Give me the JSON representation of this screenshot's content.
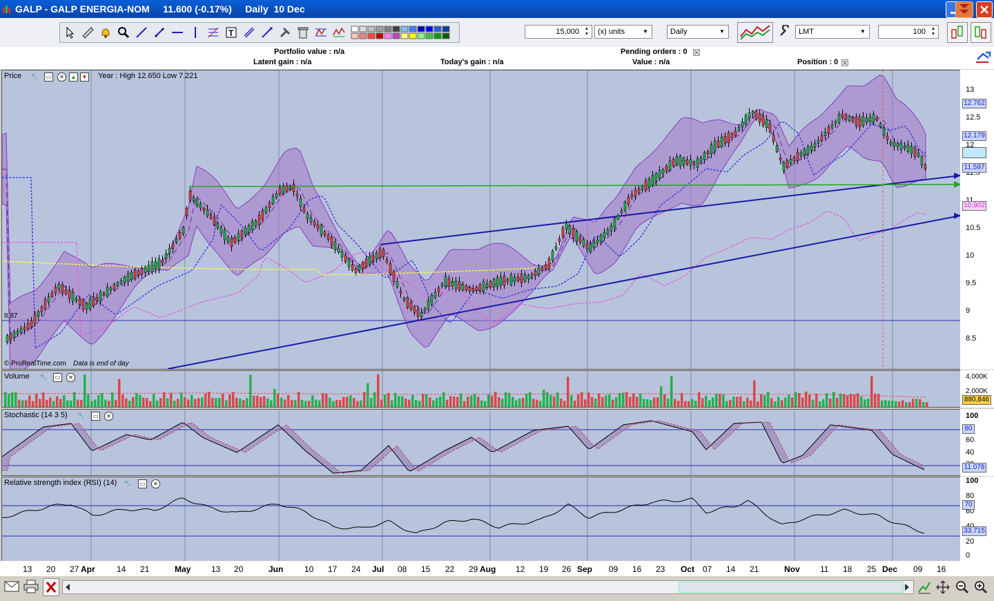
{
  "window": {
    "title": "GALP - GALP ENERGIA-NOM     11.600 (-0.17%)     Daily  10 Dec"
  },
  "toolbar": {
    "quantity": "15,000",
    "units": "(x) units",
    "timeframe": "Daily",
    "order_type": "LMT",
    "amount": "100"
  },
  "info": {
    "portfolio_value": "Portfolio value : n/a",
    "latent_gain": "Latent gain : n/a",
    "todays_gain": "Today's gain : n/a",
    "pending_orders": "Pending orders : 0",
    "value": "Value : n/a",
    "position": "Position : 0"
  },
  "price_panel": {
    "title": "Price",
    "year_range": "Year : High 12.650 Low 7.221",
    "footer_brand": "© ProRealTime.com",
    "footer_note": "Data is end of day",
    "low_marker": "8.87",
    "axis_ticks": [
      "13",
      "12.5",
      "12",
      "11.5",
      "11",
      "10.5",
      "10",
      "9.5",
      "9",
      "8.5"
    ],
    "badges": {
      "upper_band": "12.762",
      "mid_band": "12.179",
      "last_price": "11.597",
      "ma": "10.902"
    },
    "colors": {
      "band_fill": "#a478c8",
      "up_candle": "#22b14c",
      "down_candle": "#d84848",
      "trendline": "#1a1aa8",
      "support": "#1ea81e",
      "ma_fast": "#4040e0",
      "ma_slow": "#e060e0",
      "ma_long": "#ffff40"
    }
  },
  "volume_panel": {
    "title": "Volume",
    "axis_ticks": [
      "4,000K",
      "2,000K"
    ],
    "badge": "880,846"
  },
  "stochastic_panel": {
    "title": "Stochastic (14 3 5)",
    "axis_ticks": [
      "100",
      "80",
      "60",
      "40",
      "20"
    ],
    "badges": {
      "level": "80",
      "value": "11.078"
    }
  },
  "rsi_panel": {
    "title": "Relative strength index (RSI) (14)",
    "axis_ticks": [
      "100",
      "80",
      "60",
      "40",
      "20",
      "0"
    ],
    "badges": {
      "level": "70",
      "value": "33.715"
    }
  },
  "x_axis": {
    "labels": [
      {
        "text": "13",
        "bold": false
      },
      {
        "text": "20",
        "bold": false
      },
      {
        "text": "27",
        "bold": false
      },
      {
        "text": "Apr",
        "bold": true
      },
      {
        "text": "14",
        "bold": false
      },
      {
        "text": "21",
        "bold": false
      },
      {
        "text": "May",
        "bold": true
      },
      {
        "text": "13",
        "bold": false
      },
      {
        "text": "20",
        "bold": false
      },
      {
        "text": "Jun",
        "bold": true
      },
      {
        "text": "10",
        "bold": false
      },
      {
        "text": "17",
        "bold": false
      },
      {
        "text": "24",
        "bold": false
      },
      {
        "text": "Jul",
        "bold": true
      },
      {
        "text": "08",
        "bold": false
      },
      {
        "text": "15",
        "bold": false
      },
      {
        "text": "22",
        "bold": false
      },
      {
        "text": "29",
        "bold": false
      },
      {
        "text": "Aug",
        "bold": true
      },
      {
        "text": "12",
        "bold": false
      },
      {
        "text": "19",
        "bold": false
      },
      {
        "text": "26",
        "bold": false
      },
      {
        "text": "Sep",
        "bold": true
      },
      {
        "text": "09",
        "bold": false
      },
      {
        "text": "16",
        "bold": false
      },
      {
        "text": "23",
        "bold": false
      },
      {
        "text": "Oct",
        "bold": true
      },
      {
        "text": "07",
        "bold": false
      },
      {
        "text": "14",
        "bold": false
      },
      {
        "text": "21",
        "bold": false
      },
      {
        "text": "Nov",
        "bold": true
      },
      {
        "text": "11",
        "bold": false
      },
      {
        "text": "18",
        "bold": false
      },
      {
        "text": "25",
        "bold": false
      },
      {
        "text": "Dec",
        "bold": true
      },
      {
        "text": "09",
        "bold": false
      },
      {
        "text": "16",
        "bold": false
      }
    ]
  },
  "icons": [
    "app-icon",
    "minimize-icon",
    "close-icon",
    "pointer-icon",
    "ruler-icon",
    "alert-icon",
    "zoom-icon",
    "line-icon",
    "hline-icon",
    "vline-icon",
    "fib-icon",
    "text-icon",
    "channel-icon",
    "tools-icon",
    "trash-icon",
    "pattern-icon",
    "color-palette-icon",
    "chart-style-icon",
    "wrench-icon",
    "buy-icon",
    "sell-icon",
    "email-icon",
    "print-icon",
    "delete-icon",
    "scroll-left-icon",
    "scroll-right-icon",
    "fit-icon",
    "expand-icon",
    "zoom-out-icon",
    "zoom-in-icon"
  ]
}
